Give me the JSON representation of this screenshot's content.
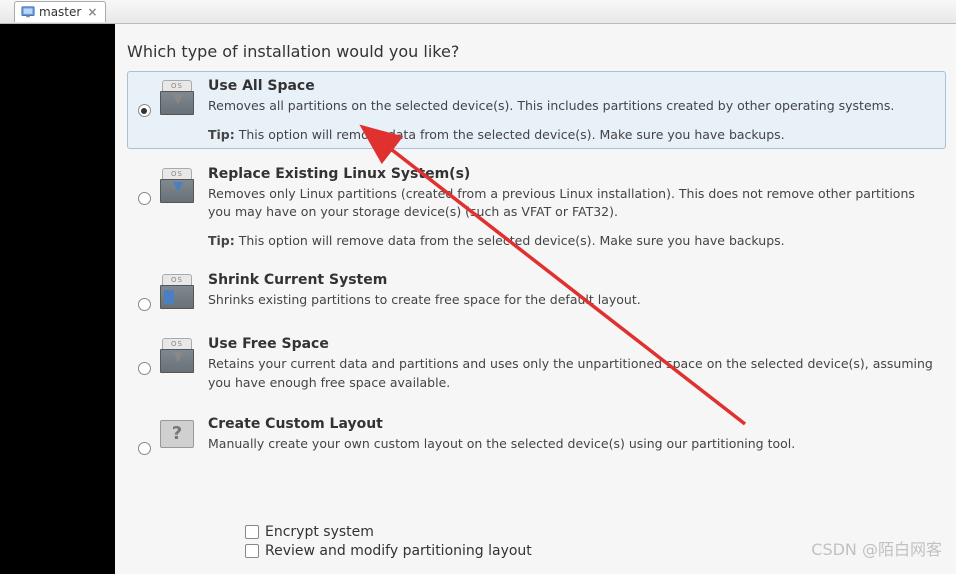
{
  "tab": {
    "label": "master"
  },
  "prompt": "Which type of installation would you like?",
  "options": [
    {
      "id": "use-all-space",
      "title": "Use All Space",
      "desc": "Removes all partitions on the selected device(s).  This includes partitions created by other operating systems.",
      "tip_label": "Tip:",
      "tip": "This option will remove data from the selected device(s).  Make sure you have backups.",
      "selected": true,
      "icon": "os-gray"
    },
    {
      "id": "replace-linux",
      "title": "Replace Existing Linux System(s)",
      "desc": "Removes only Linux partitions (created from a previous Linux installation).  This does not remove other partitions you may have on your storage device(s) (such as VFAT or FAT32).",
      "tip_label": "Tip:",
      "tip": "This option will remove data from the selected device(s).  Make sure you have backups.",
      "selected": false,
      "icon": "os-blue"
    },
    {
      "id": "shrink",
      "title": "Shrink Current System",
      "desc": "Shrinks existing partitions to create free space for the default layout.",
      "selected": false,
      "icon": "os-shrink"
    },
    {
      "id": "free-space",
      "title": "Use Free Space",
      "desc": "Retains your current data and partitions and uses only the unpartitioned space on the selected device(s), assuming you have enough free space available.",
      "selected": false,
      "icon": "os-gray"
    },
    {
      "id": "custom",
      "title": "Create Custom Layout",
      "desc": "Manually create your own custom layout on the selected device(s) using our partitioning tool.",
      "selected": false,
      "icon": "question"
    }
  ],
  "checkboxes": {
    "encrypt": "Encrypt system",
    "review": "Review and modify partitioning layout"
  },
  "watermark": "CSDN @陌白网客",
  "os_badge_text": "OS"
}
